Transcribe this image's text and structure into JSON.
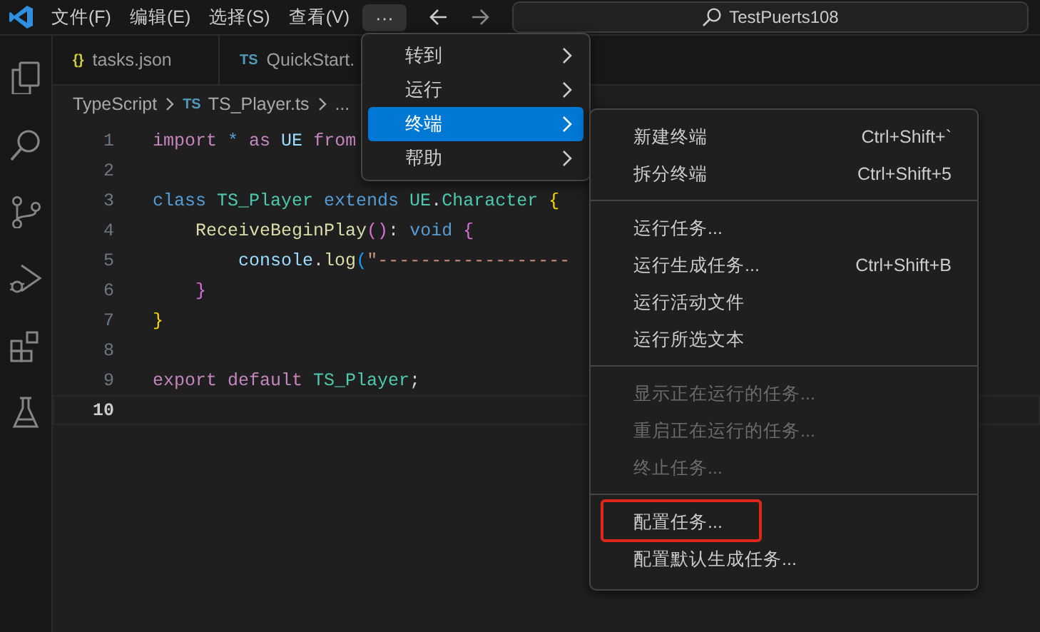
{
  "title_bar": {
    "menus": [
      {
        "label": "文件(F)"
      },
      {
        "label": "编辑(E)"
      },
      {
        "label": "选择(S)"
      },
      {
        "label": "查看(V)"
      }
    ],
    "more_button": {
      "label": "···",
      "selected": true
    },
    "search": {
      "value": "TestPuerts108"
    }
  },
  "tabs": [
    {
      "badge": "{}",
      "kind": "json",
      "label": "tasks.json",
      "selected": false
    },
    {
      "badge": "TS",
      "kind": "ts",
      "label": "QuickStart.",
      "selected": false
    }
  ],
  "breadcrumb": [
    {
      "label": "TypeScript"
    },
    {
      "badge": "TS",
      "label": "TS_Player.ts"
    },
    {
      "label": "..."
    }
  ],
  "editor": {
    "lines": [
      {
        "number": "1",
        "current": false,
        "tokens": [
          {
            "text": "import ",
            "kind": "control"
          },
          {
            "text": "* ",
            "kind": "keyword"
          },
          {
            "text": "as",
            "kind": "control"
          },
          {
            "text": " UE ",
            "kind": "var"
          },
          {
            "text": "from",
            "kind": "control"
          }
        ]
      },
      {
        "number": "2",
        "current": false
      },
      {
        "number": "3",
        "current": false,
        "tokens": [
          {
            "text": "class ",
            "kind": "keyword"
          },
          {
            "text": "TS_Player ",
            "kind": "type"
          },
          {
            "text": "extends ",
            "kind": "keyword"
          },
          {
            "text": "UE",
            "kind": "type"
          },
          {
            "text": ".",
            "kind": "plain"
          },
          {
            "text": "Character ",
            "kind": "type"
          },
          {
            "text": "{",
            "kind": "bracket1"
          }
        ]
      },
      {
        "number": "4",
        "current": false,
        "tokens": [
          {
            "text": "    ReceiveBeginPlay",
            "kind": "func"
          },
          {
            "text": "()",
            "kind": "bracket2"
          },
          {
            "text": ": ",
            "kind": "plain"
          },
          {
            "text": "void ",
            "kind": "keyword"
          },
          {
            "text": "{",
            "kind": "bracket2"
          }
        ]
      },
      {
        "number": "5",
        "current": false,
        "tokens": [
          {
            "text": "        console",
            "kind": "var"
          },
          {
            "text": ".",
            "kind": "plain"
          },
          {
            "text": "log",
            "kind": "func"
          },
          {
            "text": "(",
            "kind": "bracket3"
          },
          {
            "text": "\"------------------",
            "kind": "string"
          }
        ]
      },
      {
        "number": "6",
        "current": false,
        "tokens": [
          {
            "text": "    }",
            "kind": "bracket2"
          }
        ]
      },
      {
        "number": "7",
        "current": false,
        "tokens": [
          {
            "text": "}",
            "kind": "bracket1"
          }
        ]
      },
      {
        "number": "8",
        "current": false
      },
      {
        "number": "9",
        "current": false,
        "tokens": [
          {
            "text": "export ",
            "kind": "control"
          },
          {
            "text": "default ",
            "kind": "control"
          },
          {
            "text": "TS_Player",
            "kind": "type"
          },
          {
            "text": ";",
            "kind": "plain"
          }
        ]
      },
      {
        "number": "10",
        "current": true
      }
    ]
  },
  "menu": {
    "items": [
      {
        "label": "转到",
        "selected": false
      },
      {
        "label": "运行",
        "selected": false
      },
      {
        "label": "终端",
        "selected": true
      },
      {
        "label": "帮助",
        "selected": false
      }
    ]
  },
  "submenu": {
    "groups": [
      [
        {
          "label": "新建终端",
          "shortcut": "Ctrl+Shift+`",
          "disabled": false,
          "highlighted": false
        },
        {
          "label": "拆分终端",
          "shortcut": "Ctrl+Shift+5",
          "disabled": false,
          "highlighted": false
        }
      ],
      [
        {
          "label": "运行任务...",
          "disabled": false,
          "highlighted": false
        },
        {
          "label": "运行生成任务...",
          "shortcut": "Ctrl+Shift+B",
          "disabled": false,
          "highlighted": false
        },
        {
          "label": "运行活动文件",
          "disabled": false,
          "highlighted": false
        },
        {
          "label": "运行所选文本",
          "disabled": false,
          "highlighted": false
        }
      ],
      [
        {
          "label": "显示正在运行的任务...",
          "disabled": true,
          "highlighted": false
        },
        {
          "label": "重启正在运行的任务...",
          "disabled": true,
          "highlighted": false
        },
        {
          "label": "终止任务...",
          "disabled": true,
          "highlighted": false
        }
      ],
      [
        {
          "label": "配置任务...",
          "disabled": false,
          "highlighted": true
        },
        {
          "label": "配置默认生成任务...",
          "disabled": false,
          "highlighted": false
        }
      ]
    ]
  }
}
